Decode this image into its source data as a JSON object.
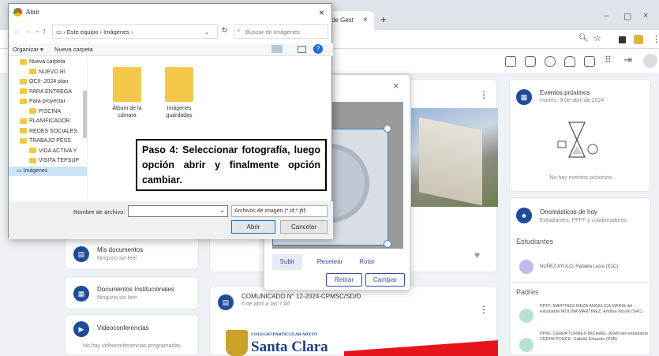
{
  "browser": {
    "tab_title": "de Gest",
    "tab_close": "×",
    "new_tab": "+",
    "min": "–",
    "restore": "▢",
    "close": "×"
  },
  "sidebar": {
    "items": [
      {
        "title": "Mis documentos",
        "sub": "Ninguno sin leer"
      },
      {
        "title": "Documentos Institucionales",
        "sub": "Ninguno sin leer"
      },
      {
        "title": "Videoconferencias",
        "sub": "No hay videoconferencias programadas"
      }
    ]
  },
  "feed": {
    "comunicado_title": "COMUNICADO N° 12-2024-CPMSC/SD/D",
    "comunicado_date": "6 de abril a las 7:46",
    "school_small": "COLEGIO PARTICULAR MIXTO",
    "school_big": "Santa Clara",
    "menu_dots": "⋮"
  },
  "events": {
    "title": "Eventos próximos",
    "date": "martes, 9 de abril de 2024",
    "empty": "No hay eventos próximos"
  },
  "birthdays": {
    "title": "Onomásticos de hoy",
    "sub": "Estudiantes, PPFF y colaboradores"
  },
  "students": {
    "header": "Estudiantes",
    "items": [
      "NUÑEZ AYULO, Rafaela Lucia (S1C)"
    ]
  },
  "parents": {
    "header": "Padres",
    "items": [
      "PPFF. MARTINEZ MEZA ANGELICA MARIA del estudiante MOLINA MARTINEZ, Andrea Nicole (S4C)",
      "PPFF. CERPA TORRES MICHAEL JOHN del estudiante CERPA PONCE, Gabriel Eduardo (P6B)"
    ]
  },
  "modal": {
    "close": "×",
    "subir": "Subir",
    "resetear": "Resetear",
    "rotar": "Rotar",
    "retirar": "Retirar",
    "cambiar": "Cambiar"
  },
  "dialog": {
    "title": "Abrir",
    "close": "×",
    "path": [
      "Este equipo",
      "Imágenes"
    ],
    "search_placeholder": "Buscar en Imágenes",
    "organize": "Organizar ▾",
    "new_folder": "Nueva carpeta",
    "tree": [
      "Nueva carpeta",
      "NUEVO RI",
      "OCII- 2024 plan",
      "PARA ENTREGA",
      "Para proyectar",
      "PISCINA",
      "PLANIFICADOR",
      "REDES SOCIALES",
      "TRABAJO PESS",
      "VIDA ACTIVA Y",
      "VISITA TEPSUP",
      "Imágenes"
    ],
    "folders": [
      {
        "name": "Álbum de la cámara"
      },
      {
        "name": "Imágenes guardadas"
      }
    ],
    "filename_label": "Nombre de archivo:",
    "filetype": "Archivos de imagen (*.tif;*.jfif;",
    "open": "Abrir",
    "cancel": "Cancelar"
  },
  "step_text": "Paso 4: Seleccionar fotografía, luego opción abrir y finalmente opción cambiar."
}
